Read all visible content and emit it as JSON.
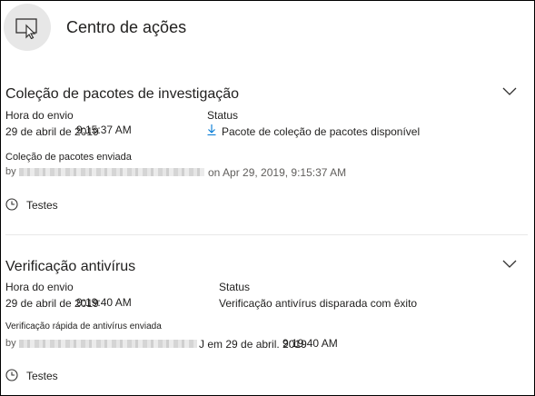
{
  "header": {
    "title": "Centro de ações",
    "icon": "action-center-icon"
  },
  "sections": [
    {
      "title": "Coleção de pacotes de investigação",
      "submit_label": "Hora do envio",
      "submit_date": "29 de abril de 2019",
      "submit_time": "9:15:37 AM",
      "status_label": "Status",
      "status_value": "Pacote de coleção de pacotes disponível",
      "status_icon": "download-icon",
      "event_label": "Coleção de pacotes enviada",
      "by_prefix": "by",
      "by_suffix": "on Apr 29, 2019, 9:15:37 AM",
      "tag": "Testes"
    },
    {
      "title": "Verificação antivírus",
      "submit_label": "Hora do envio",
      "submit_date": "29 de abril de 2019",
      "submit_time": "9:19:40 AM",
      "status_label": "Status",
      "status_value": "Verificação antivírus disparada com êxito",
      "event_label": "Verificação rápida de antivírus enviada",
      "by_prefix": "by",
      "by_suffix_date": "J em 29 de abril. 2019",
      "by_suffix_time": "9:19:40 AM",
      "tag": "Testes"
    }
  ]
}
